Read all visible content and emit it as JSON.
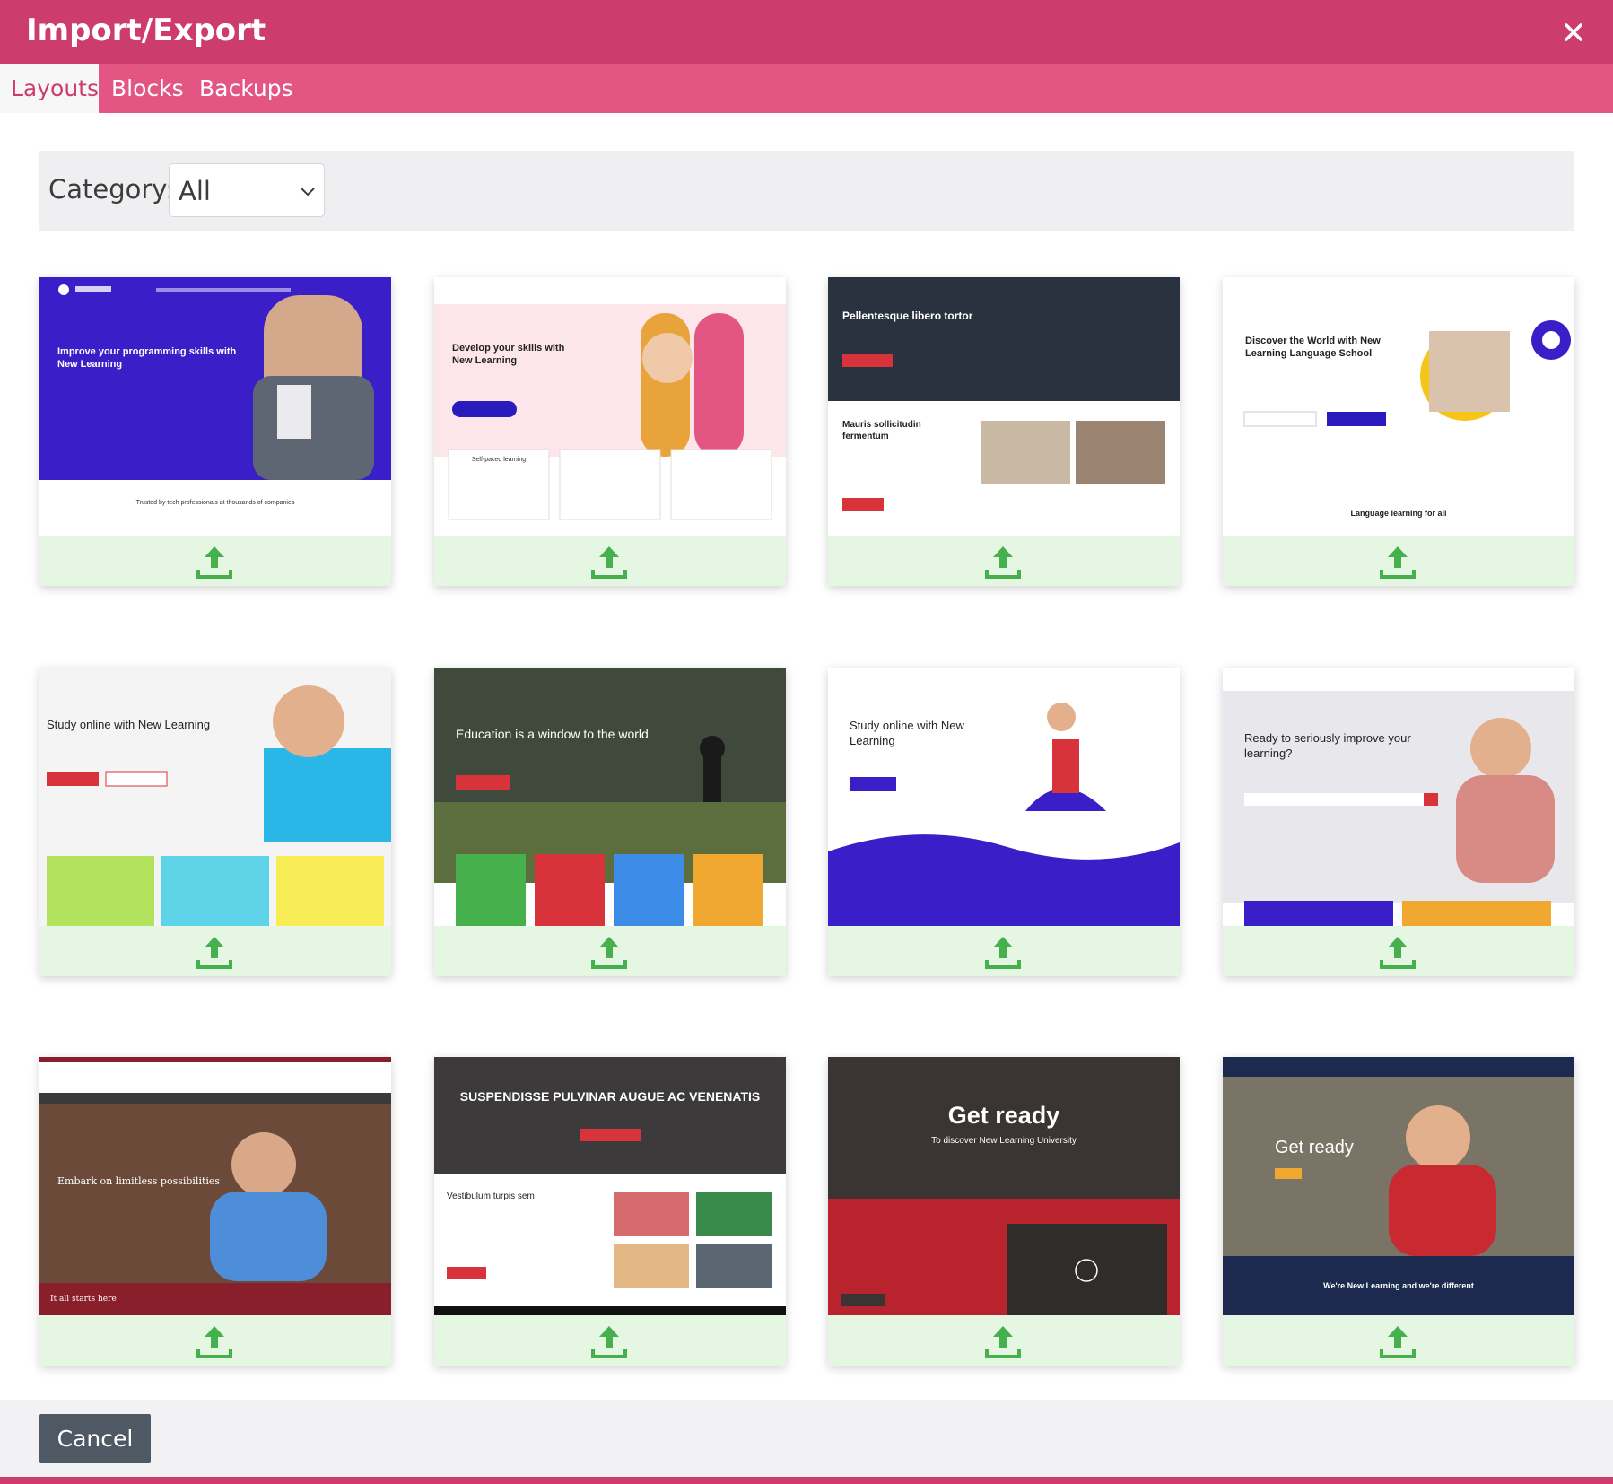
{
  "dialog": {
    "title": "Import/Export",
    "close_icon": "close-icon",
    "accent_color": "#cc3d6d",
    "tab_bar_color": "#e35683"
  },
  "tabs": [
    {
      "label": "Layouts",
      "active": true
    },
    {
      "label": "Blocks",
      "active": false
    },
    {
      "label": "Backups",
      "active": false
    }
  ],
  "filter": {
    "label": "Category:",
    "selected": "All",
    "dropdown_icon": "chevron-down-icon"
  },
  "layouts": [
    {
      "heading": "Improve your programming skills with New Learning",
      "footer_text": "Trusted by tech professionals at thousands of companies",
      "icon": "upload-icon"
    },
    {
      "heading": "Develop your skills with New Learning",
      "footer_text": "Self-paced learning",
      "icon": "upload-icon"
    },
    {
      "heading": "Pellentesque libero tortor",
      "footer_text": "Mauris sollicitudin fermentum",
      "icon": "upload-icon"
    },
    {
      "heading": "Discover the World with New Learning Language School",
      "footer_text": "Language learning for all",
      "icon": "upload-icon"
    },
    {
      "heading": "Study online with New Learning",
      "footer_text": "",
      "icon": "upload-icon"
    },
    {
      "heading": "Education is a window to the world",
      "footer_text": "",
      "icon": "upload-icon"
    },
    {
      "heading": "Study online with New Learning",
      "footer_text": "",
      "icon": "upload-icon"
    },
    {
      "heading": "Ready to seriously improve your learning?",
      "footer_text": "",
      "icon": "upload-icon"
    },
    {
      "heading": "Embark on limitless possibilities",
      "footer_text": "It all starts here",
      "icon": "upload-icon"
    },
    {
      "heading": "SUSPENDISSE PULVINAR AUGUE AC VENENATIS",
      "footer_text": "Vestibulum turpis sem",
      "icon": "upload-icon"
    },
    {
      "heading": "Get ready",
      "footer_text": "To discover New Learning University",
      "icon": "upload-icon"
    },
    {
      "heading": "Get ready",
      "footer_text": "We're New Learning and we're different",
      "icon": "upload-icon"
    }
  ],
  "footer": {
    "cancel_label": "Cancel"
  }
}
